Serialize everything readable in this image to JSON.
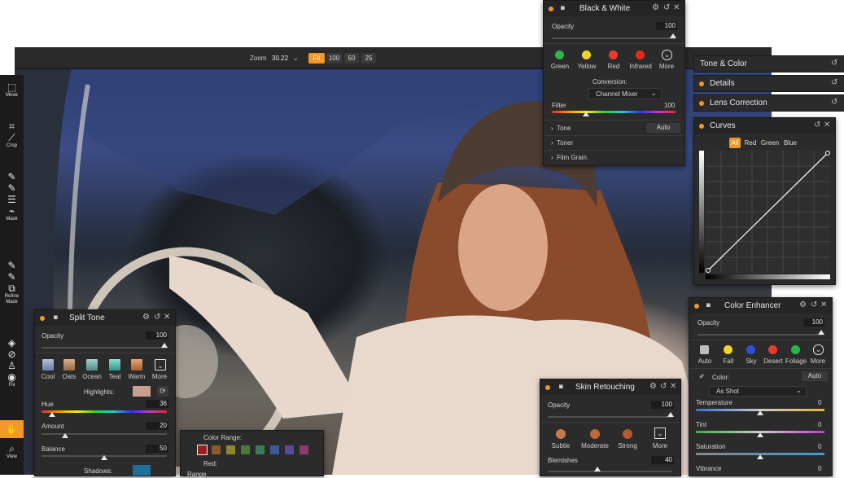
{
  "topbar": {
    "zoom_label": "Zoom",
    "zoom_value": "30.22",
    "zoom_buttons": [
      "Fit",
      "100",
      "50",
      "25"
    ],
    "active_zoom": "Fit"
  },
  "tools": [
    {
      "label": "Move",
      "icon": "move-icon"
    },
    {
      "label": "Crop",
      "icon": "crop-icon"
    },
    {
      "label": "Mask",
      "icon": "brush-icon"
    },
    {
      "label": "Refine Mask",
      "icon": "refine-icon"
    },
    {
      "label": "Fix",
      "icon": "heal-icon"
    },
    {
      "label": "View",
      "icon": "hand-icon"
    }
  ],
  "black_white": {
    "title": "Black & White",
    "opacity_label": "Opacity",
    "opacity_value": "100",
    "filters": [
      {
        "label": "Green",
        "color": "#2fb34a"
      },
      {
        "label": "Yellow",
        "color": "#f1d42a"
      },
      {
        "label": "Red",
        "color": "#e83b2c"
      },
      {
        "label": "Infrared",
        "color": "#e8281d"
      },
      {
        "label": "More",
        "color": "#2b2b2b"
      }
    ],
    "conversion_label": "Conversion:",
    "conversion_value": "Channel Mixer",
    "filter_label": "Filter",
    "filter_value": "100",
    "sections": [
      "Tone",
      "Toner",
      "Film Grain"
    ],
    "auto_label": "Auto"
  },
  "collapsed_panels": [
    "Tone & Color",
    "Details",
    "Lens Correction"
  ],
  "curves": {
    "title": "Curves",
    "channels": [
      "All",
      "Red",
      "Green",
      "Blue"
    ],
    "active": "All"
  },
  "split_tone": {
    "title": "Split Tone",
    "opacity_label": "Opacity",
    "opacity_value": "100",
    "presets": [
      {
        "label": "Cool",
        "color": "#7f8fb5"
      },
      {
        "label": "Oats",
        "color": "#b98c62"
      },
      {
        "label": "Ocean",
        "color": "#6fa6a0"
      },
      {
        "label": "Teal",
        "color": "#56b6a8"
      },
      {
        "label": "Warm",
        "color": "#c98454"
      },
      {
        "label": "More",
        "color": "#2b2b2b"
      }
    ],
    "highlights_label": "Highlights:",
    "highlights_color": "#c8a08e",
    "hue_label": "Hue",
    "hue_value": "36",
    "amount_label": "Amount",
    "amount_value": "20",
    "balance_label": "Balance",
    "balance_value": "50",
    "shadows_label": "Shadows:",
    "shadows_color": "#1f6f9a"
  },
  "color_range": {
    "label": "Color Range:",
    "swatches": [
      "#9a2020",
      "#8a5a30",
      "#8a8a30",
      "#4a7a3a",
      "#3a7a5a",
      "#3a5a9a",
      "#5a4a9a",
      "#8a3a6a"
    ],
    "red_label": "Red:",
    "range_label": "Range"
  },
  "skin": {
    "title": "Skin Retouching",
    "opacity_label": "Opacity",
    "opacity_value": "100",
    "presets": [
      "Subtle",
      "Moderate",
      "Strong",
      "More"
    ],
    "blemishes_label": "Blemishes",
    "blemishes_value": "40"
  },
  "enhancer": {
    "title": "Color Enhancer",
    "opacity_label": "Opacity",
    "opacity_value": "100",
    "presets": [
      {
        "label": "Auto",
        "color": "#bdbdbd"
      },
      {
        "label": "Fall",
        "color": "#f1d42a"
      },
      {
        "label": "Sky",
        "color": "#2f4fd8"
      },
      {
        "label": "Desert",
        "color": "#e83b2c"
      },
      {
        "label": "Foliage",
        "color": "#2fb34a"
      },
      {
        "label": "More",
        "color": "#2b2b2b"
      }
    ],
    "color_label": "Color:",
    "auto_label": "Auto",
    "wb_value": "As Shot",
    "temperature_label": "Temperature",
    "temperature_value": "0",
    "tint_label": "Tint",
    "tint_value": "0",
    "saturation_label": "Saturation",
    "saturation_value": "0",
    "vibrance_label": "Vibrance",
    "vibrance_value": "0"
  }
}
